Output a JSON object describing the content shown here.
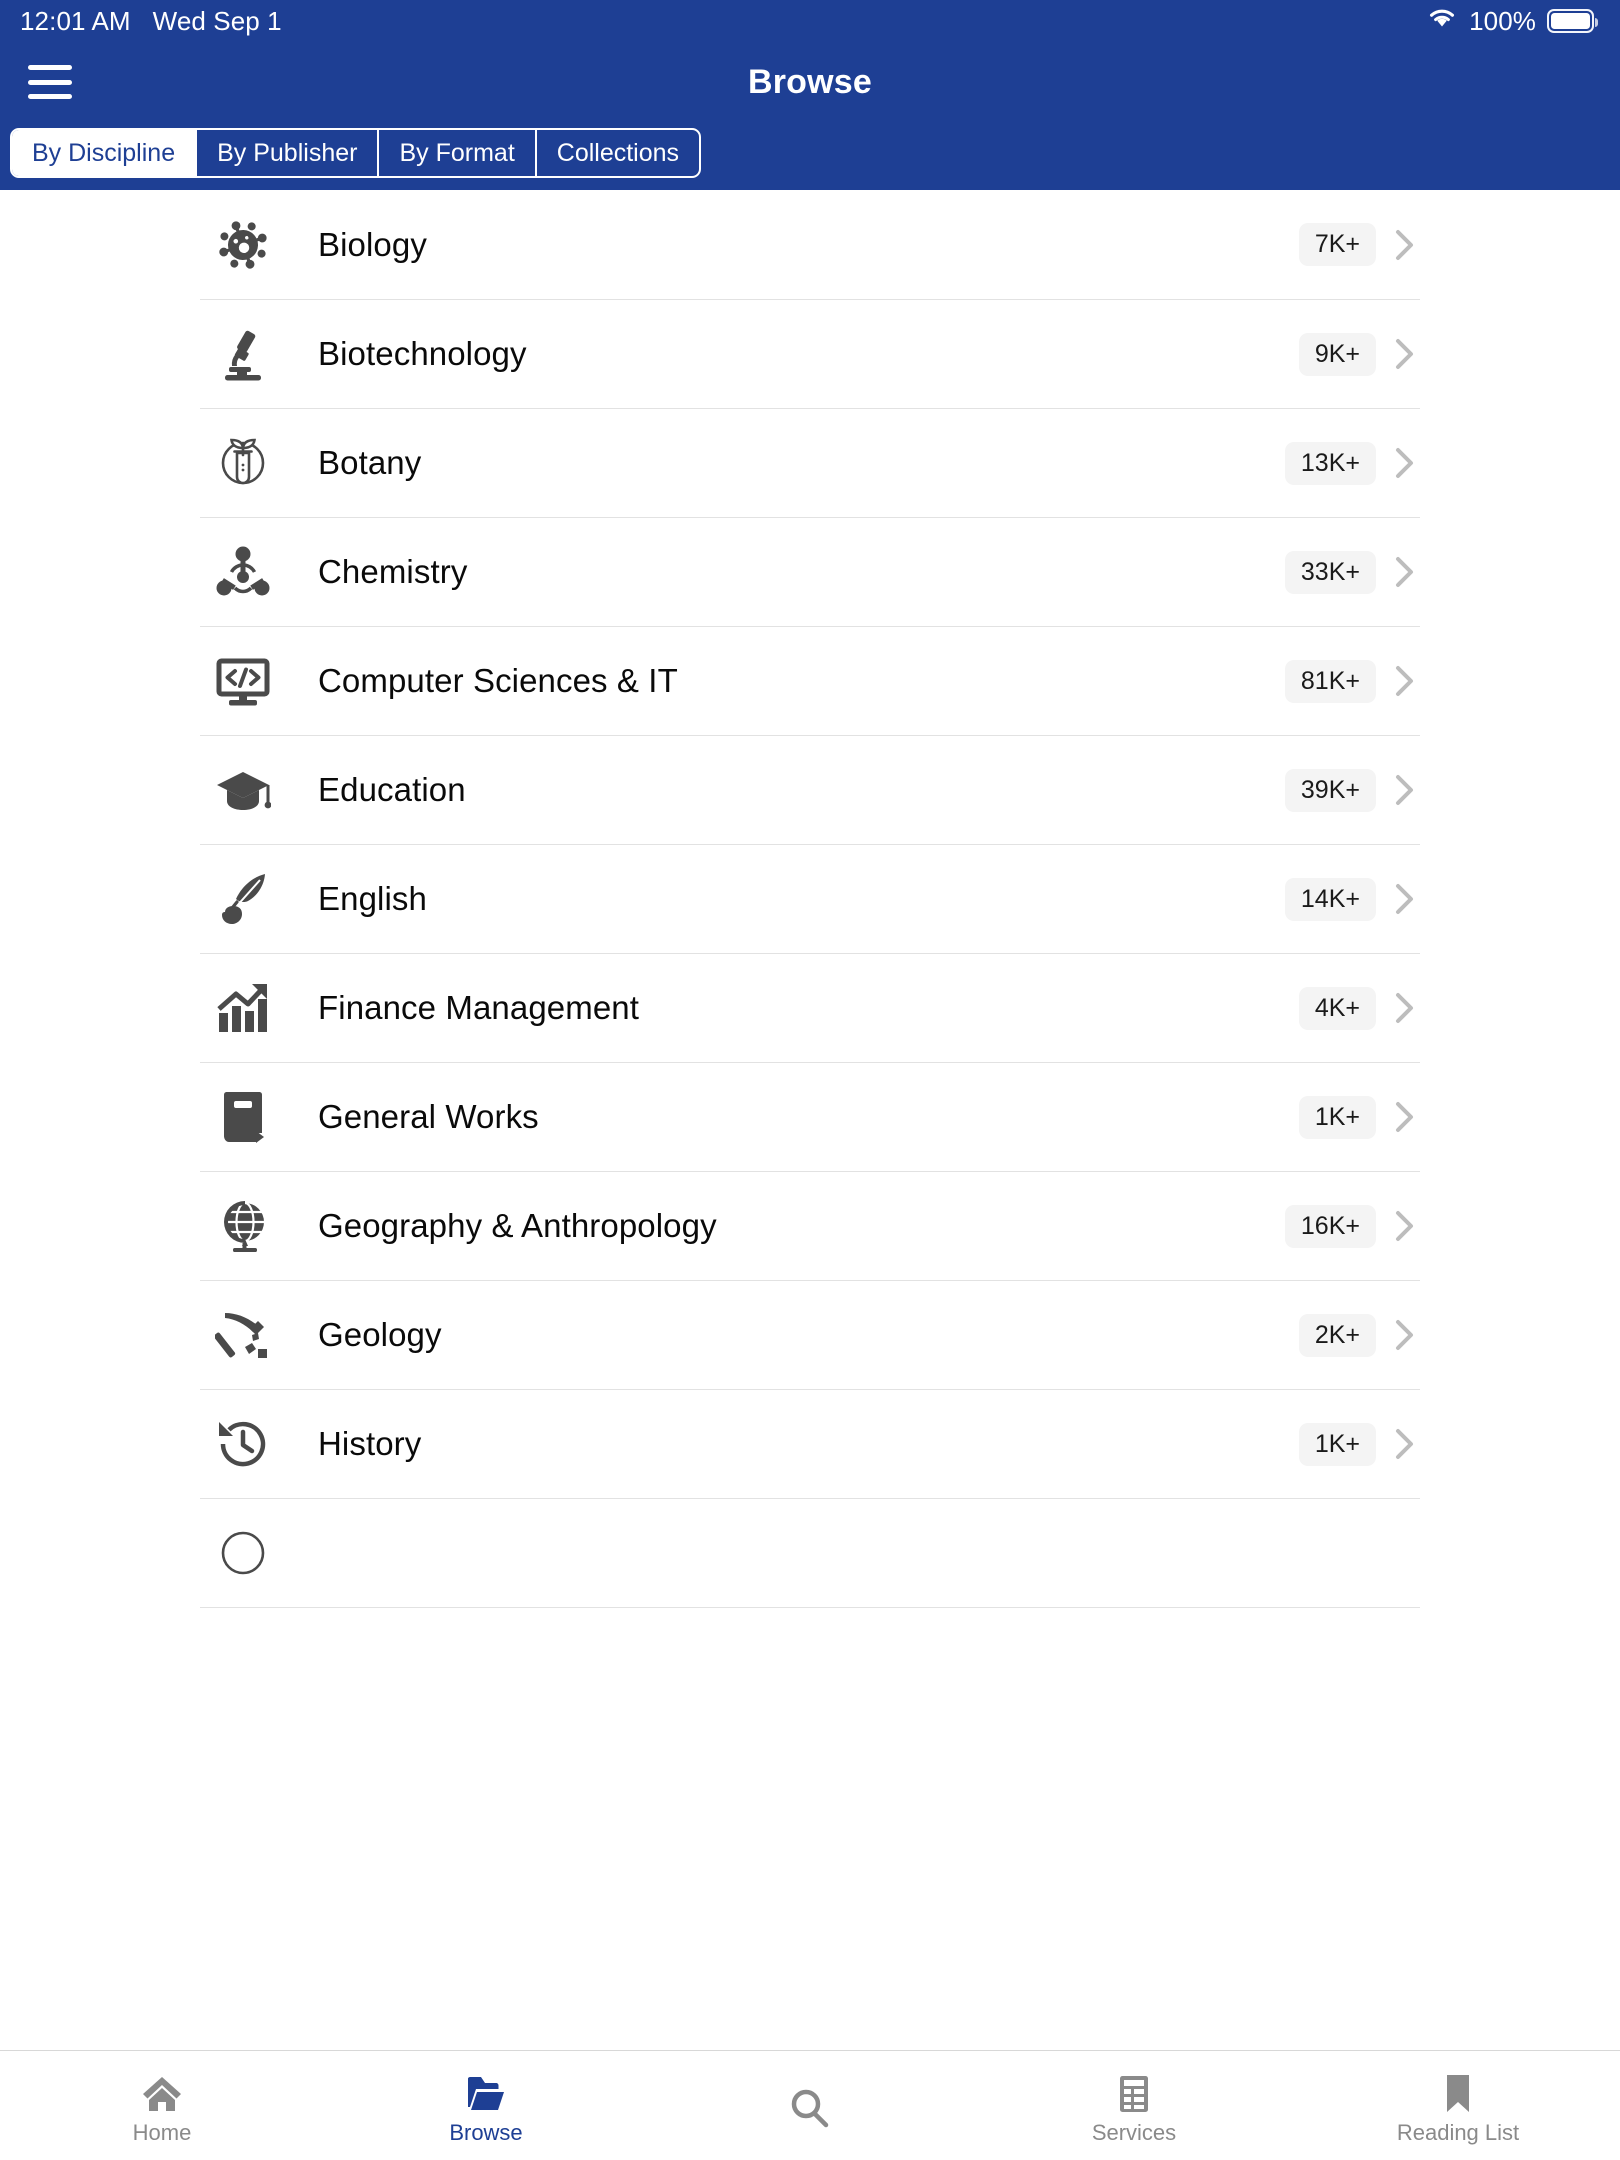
{
  "statusbar": {
    "time": "12:01 AM",
    "date": "Wed Sep 1",
    "battery_percent": "100%",
    "wifi_icon": "wifi-icon",
    "battery_icon": "battery-full-icon"
  },
  "header": {
    "title": "Browse",
    "menu_icon": "hamburger-menu-icon",
    "accent_color": "#1e3f94",
    "tabs": [
      {
        "label": "By Discipline",
        "active": true
      },
      {
        "label": "By Publisher",
        "active": false
      },
      {
        "label": "By Format",
        "active": false
      },
      {
        "label": "Collections",
        "active": false
      }
    ]
  },
  "list": {
    "items": [
      {
        "label": "Biology",
        "count": "7K+",
        "icon": "virus-icon"
      },
      {
        "label": "Biotechnology",
        "count": "9K+",
        "icon": "microscope-icon"
      },
      {
        "label": "Botany",
        "count": "13K+",
        "icon": "plant-test-tube-icon"
      },
      {
        "label": "Chemistry",
        "count": "33K+",
        "icon": "molecule-icon"
      },
      {
        "label": "Computer Sciences & IT",
        "count": "81K+",
        "icon": "code-monitor-icon"
      },
      {
        "label": "Education",
        "count": "39K+",
        "icon": "graduation-cap-icon"
      },
      {
        "label": "English",
        "count": "14K+",
        "icon": "quill-inkpot-icon"
      },
      {
        "label": "Finance Management",
        "count": "4K+",
        "icon": "bar-chart-growth-icon"
      },
      {
        "label": "General Works",
        "count": "1K+",
        "icon": "book-icon"
      },
      {
        "label": "Geography & Anthropology",
        "count": "16K+",
        "icon": "globe-stand-icon"
      },
      {
        "label": "Geology",
        "count": "2K+",
        "icon": "rock-hammer-icon"
      },
      {
        "label": "History",
        "count": "1K+",
        "icon": "clock-rewind-icon"
      }
    ]
  },
  "tabbar": {
    "items": [
      {
        "label": "Home",
        "icon": "home-icon",
        "active": false
      },
      {
        "label": "Browse",
        "icon": "folder-icon",
        "active": true
      },
      {
        "label": "",
        "icon": "search-icon",
        "active": false
      },
      {
        "label": "Services",
        "icon": "services-list-icon",
        "active": false
      },
      {
        "label": "Reading List",
        "icon": "bookmark-icon",
        "active": false
      }
    ]
  }
}
